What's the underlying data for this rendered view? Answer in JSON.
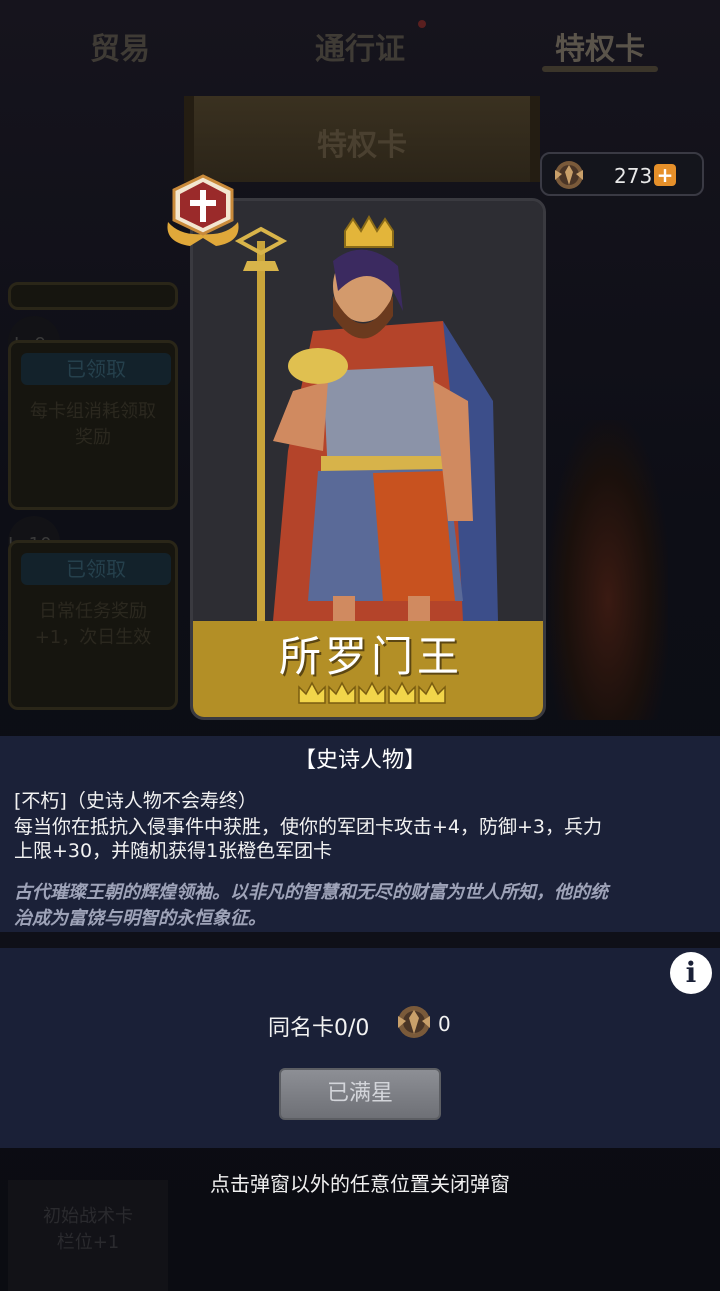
{
  "tabs": [
    {
      "label": "贸易"
    },
    {
      "label": "通行证"
    },
    {
      "label": "特权卡"
    }
  ],
  "banner": {
    "title": "特权卡"
  },
  "currency": {
    "value": "273",
    "icon": "crest-coin-icon",
    "add_label": "+"
  },
  "background_cards": [
    {
      "level": "Lv9",
      "badge": "已领取",
      "text": "每卡组消耗领取奖励"
    },
    {
      "level": "Lv10",
      "badge": "已领取",
      "text": "日常任务奖励+1，次日生效"
    }
  ],
  "card": {
    "name": "所罗门王",
    "stars": 5,
    "rank_icon": "epic-rank-badge-icon"
  },
  "description": {
    "type": "【史诗人物】",
    "line1": "[不朽]（史诗人物不会寿终）",
    "line2": "每当你在抵抗入侵事件中获胜，使你的军团卡攻击+4，防御+3，兵力",
    "line3": "上限+30，并随机获得1张橙色军团卡",
    "lore1": "古代璀璨王朝的辉煌领袖。以非凡的智慧和无尽的财富为世人所知，他的统",
    "lore2": "治成为富饶与明智的永恒象征。"
  },
  "duplicate": {
    "label": "同名卡0/0",
    "count": "0"
  },
  "max_button": {
    "label": "已满星"
  },
  "close_hint": "点击弹窗以外的任意位置关闭弹窗",
  "background_bottom": {
    "text1": "初始战术卡",
    "text2": "栏位+1"
  },
  "colors": {
    "panel": "#1b2138",
    "gold": "#b38f26",
    "button_gray": "#8d8f95",
    "plus_orange": "#e6902a"
  }
}
